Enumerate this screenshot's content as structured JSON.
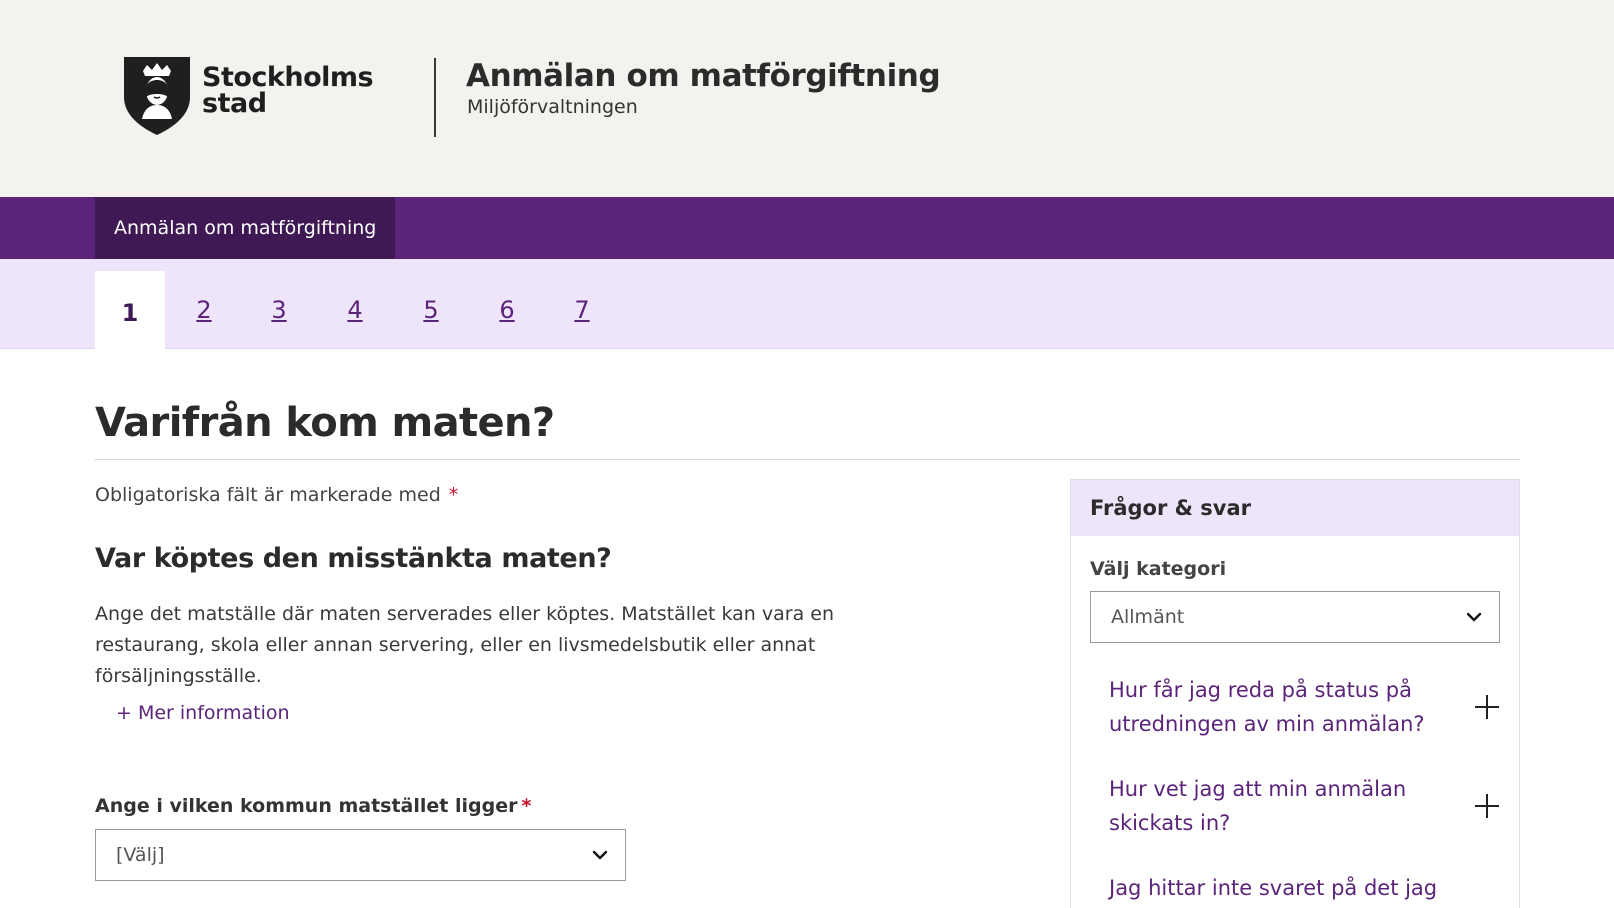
{
  "header": {
    "logo_text_line1": "Stockholms",
    "logo_text_line2": "stad",
    "app_title": "Anmälan om matförgiftning",
    "app_subtitle": "Miljöförvaltningen"
  },
  "nav": {
    "active_item": "Anmälan om matförgiftning"
  },
  "steps": [
    {
      "label": "1",
      "active": true
    },
    {
      "label": "2",
      "active": false
    },
    {
      "label": "3",
      "active": false
    },
    {
      "label": "4",
      "active": false
    },
    {
      "label": "5",
      "active": false
    },
    {
      "label": "6",
      "active": false
    },
    {
      "label": "7",
      "active": false
    }
  ],
  "main": {
    "page_title": "Varifrån kom maten?",
    "required_note": "Obligatoriska fält är markerade med",
    "required_marker": "*",
    "section_title": "Var köptes den misstänkta maten?",
    "section_text": "Ange det matställe där maten serverades eller köptes. Matstället kan vara en restaurang, skola eller annan servering, eller en livsmedelsbutik eller annat försäljningsställe.",
    "more_info": "+ Mer information",
    "municipality_label": "Ange i vilken kommun matstället ligger",
    "municipality_value": "[Välj]"
  },
  "sidebar": {
    "title": "Frågor & svar",
    "category_label": "Välj kategori",
    "category_value": "Allmänt",
    "faq": [
      "Hur får jag reda på status på utredningen av min anmälan?",
      "Hur vet jag att min anmälan skickats in?",
      "Jag hittar inte svaret på det jag"
    ]
  },
  "colors": {
    "brand_purple": "#5b247a",
    "nav_active": "#3e1953",
    "steps_bg": "#efe5fb",
    "header_bg": "#f3f2ee",
    "required_red": "#c8102e"
  }
}
